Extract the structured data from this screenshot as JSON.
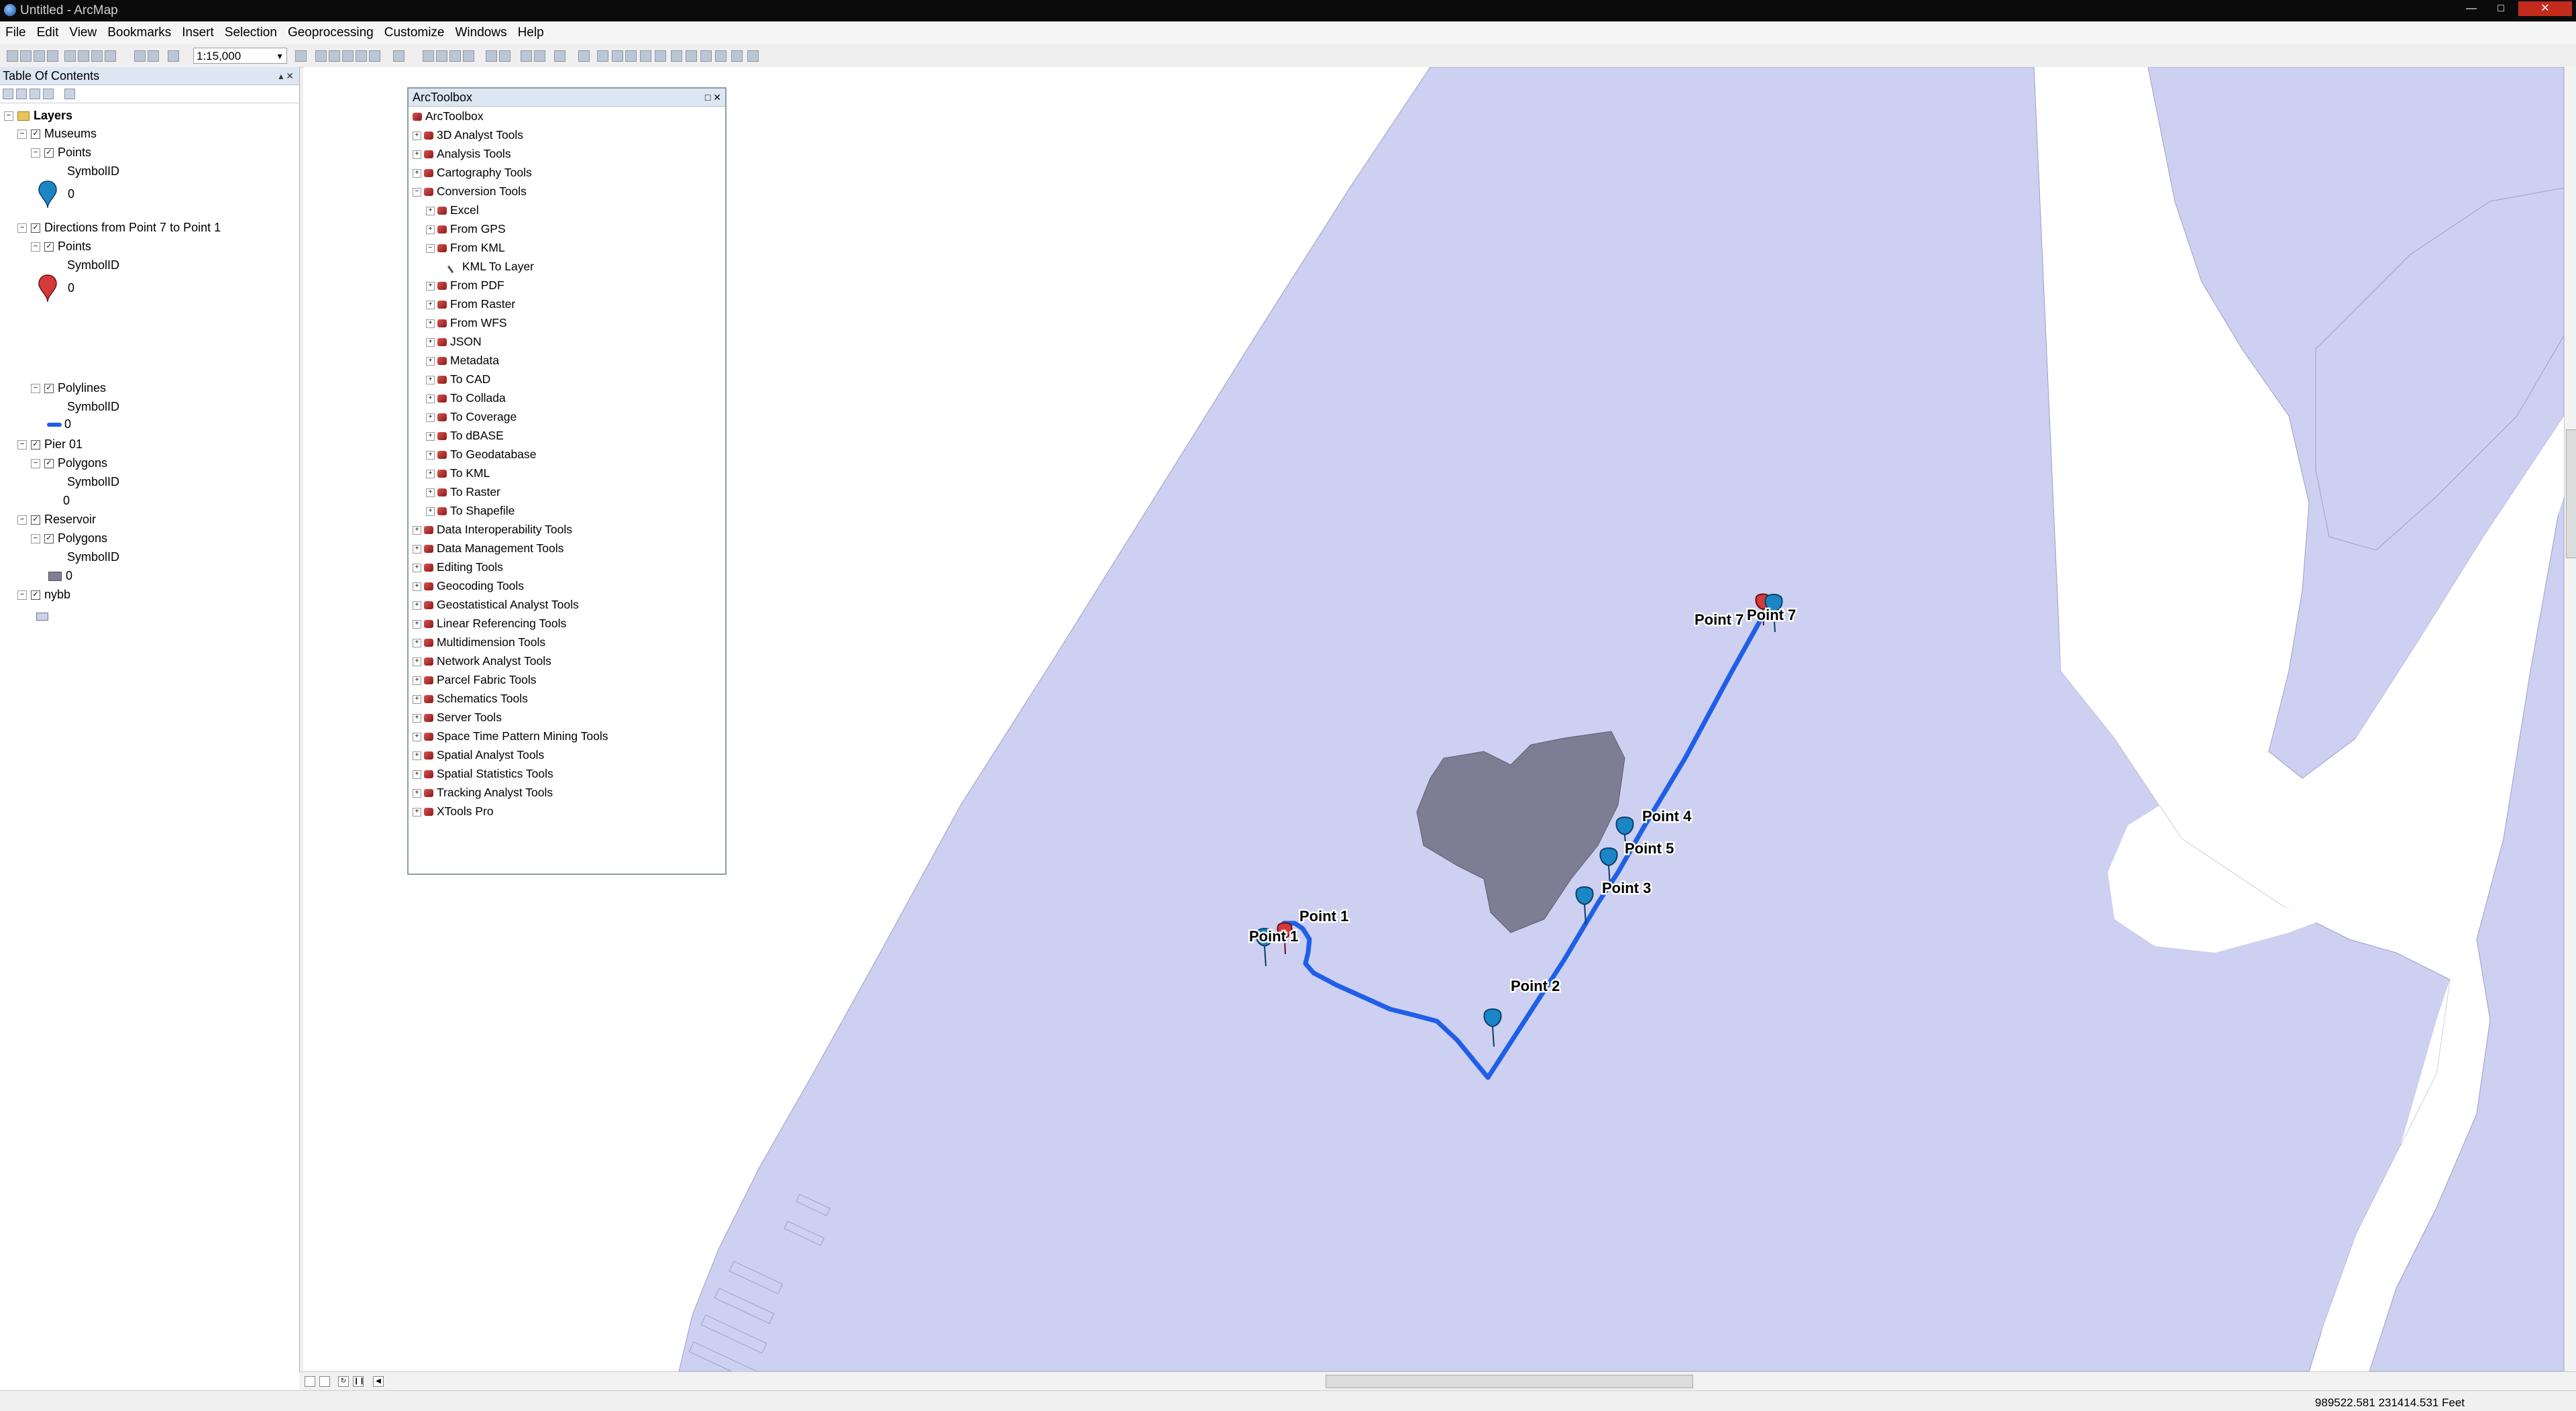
{
  "window": {
    "title": "Untitled - ArcMap"
  },
  "menu": [
    "File",
    "Edit",
    "View",
    "Bookmarks",
    "Insert",
    "Selection",
    "Geoprocessing",
    "Customize",
    "Windows",
    "Help"
  ],
  "toolbar": {
    "scale": "1:15,000"
  },
  "toc": {
    "title": "Table Of Contents",
    "root": "Layers",
    "rows": [
      {
        "label": "Museums"
      },
      {
        "label": "Points"
      },
      {
        "label": "SymbolID"
      },
      {
        "label": "0"
      },
      {
        "label": "Directions from Point 7 to Point 1"
      },
      {
        "label": "Points"
      },
      {
        "label": "SymbolID"
      },
      {
        "label": "0"
      },
      {
        "label": "Polylines"
      },
      {
        "label": "SymbolID"
      },
      {
        "label": "0"
      },
      {
        "label": "Pier 01"
      },
      {
        "label": "Polygons"
      },
      {
        "label": "SymbolID"
      },
      {
        "label": "0"
      },
      {
        "label": "Reservoir"
      },
      {
        "label": "Polygons"
      },
      {
        "label": "SymbolID"
      },
      {
        "label": "0"
      },
      {
        "label": "nybb"
      }
    ]
  },
  "toolbox": {
    "title": "ArcToolbox",
    "items": [
      "ArcToolbox",
      "3D Analyst Tools",
      "Analysis Tools",
      "Cartography Tools",
      "Conversion Tools",
      "Excel",
      "From GPS",
      "From KML",
      "KML To Layer",
      "From PDF",
      "From Raster",
      "From WFS",
      "JSON",
      "Metadata",
      "To CAD",
      "To Collada",
      "To Coverage",
      "To dBASE",
      "To Geodatabase",
      "To KML",
      "To Raster",
      "To Shapefile",
      "Data Interoperability Tools",
      "Data Management Tools",
      "Editing Tools",
      "Geocoding Tools",
      "Geostatistical Analyst Tools",
      "Linear Referencing Tools",
      "Multidimension Tools",
      "Network Analyst Tools",
      "Parcel Fabric Tools",
      "Schematics Tools",
      "Server Tools",
      "Space Time Pattern Mining Tools",
      "Spatial Analyst Tools",
      "Spatial Statistics Tools",
      "Tracking Analyst Tools",
      "XTools Pro"
    ]
  },
  "map": {
    "labels": [
      "Point 1",
      "Point 1",
      "Point 2",
      "Point 3",
      "Point 5",
      "Point 4",
      "Point 7",
      "Point 7"
    ],
    "colors": {
      "land": "#cdd0f0",
      "reservoir": "#7d7e94",
      "route": "#1f5fe8",
      "museum_pin": "#1b86c6",
      "direction_pin": "#d43a3a"
    }
  },
  "status": {
    "coordinates": "989522.581  231414.531 Feet"
  }
}
